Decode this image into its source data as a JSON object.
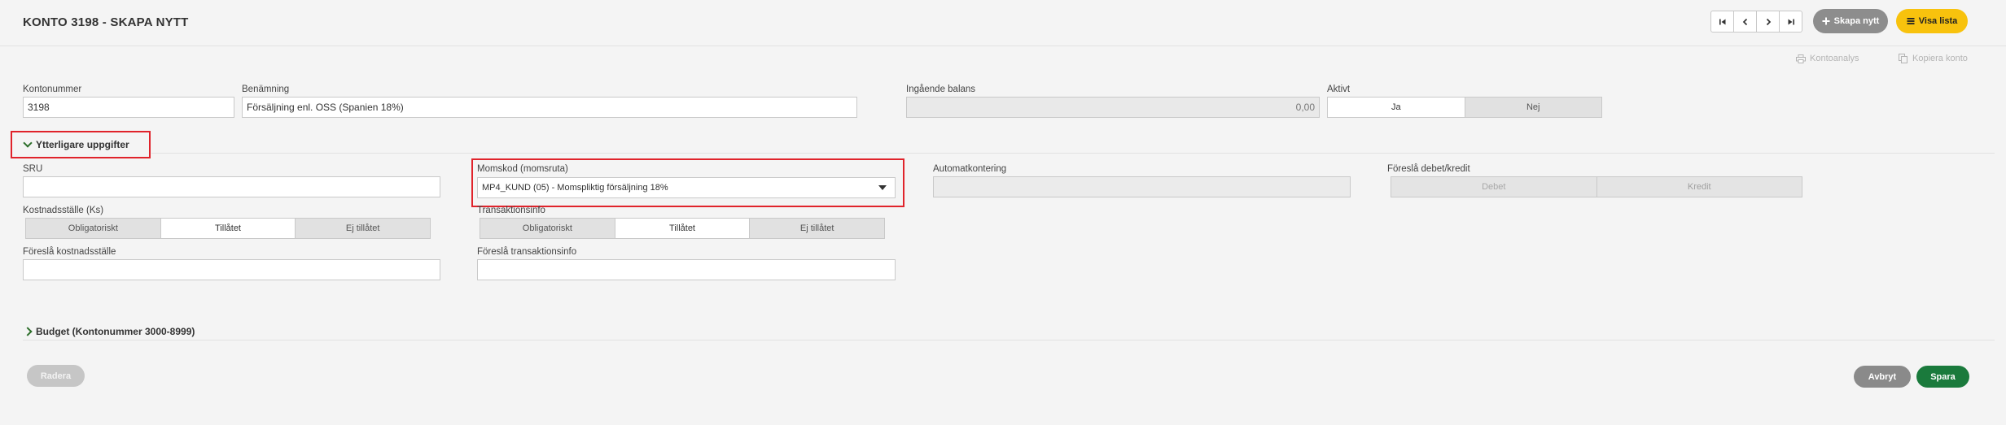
{
  "header": {
    "title": "KONTO 3198 - SKAPA NYTT",
    "create_label": "Skapa nytt",
    "list_label": "Visa lista"
  },
  "tools": {
    "account_analysis": "Kontoanalys",
    "copy_account": "Kopiera konto"
  },
  "form": {
    "account_number": {
      "label": "Kontonummer",
      "value": "3198"
    },
    "name": {
      "label": "Benämning",
      "value": "Försäljning enl. OSS (Spanien 18%)"
    },
    "opening_balance": {
      "label": "Ingående balans",
      "value": "0,00"
    },
    "active": {
      "label": "Aktivt",
      "options": [
        "Ja",
        "Nej"
      ],
      "selected": "Ja"
    }
  },
  "extra": {
    "title": "Ytterligare uppgifter",
    "sru": {
      "label": "SRU",
      "value": ""
    },
    "vat_code": {
      "label": "Momskod (momsruta)",
      "value": "MP4_KUND (05) - Momspliktig försäljning 18%"
    },
    "auto_posting": {
      "label": "Automatkontering",
      "value": ""
    },
    "suggest_debit_credit": {
      "label": "Föreslå debet/kredit",
      "options": [
        "Debet",
        "Kredit"
      ]
    },
    "cost_center": {
      "label": "Kostnadsställe (Ks)",
      "options": [
        "Obligatoriskt",
        "Tillåtet",
        "Ej tillåtet"
      ],
      "selected": "Tillåtet"
    },
    "transaction_info": {
      "label": "Transaktionsinfo",
      "options": [
        "Obligatoriskt",
        "Tillåtet",
        "Ej tillåtet"
      ],
      "selected": "Tillåtet"
    },
    "suggest_cost_center": {
      "label": "Föreslå kostnadsställe",
      "value": ""
    },
    "suggest_transaction_info": {
      "label": "Föreslå transaktionsinfo",
      "value": ""
    }
  },
  "budget": {
    "title": "Budget (Kontonummer 3000-8999)"
  },
  "footer": {
    "delete_label": "Radera",
    "cancel_label": "Avbryt",
    "save_label": "Spara"
  },
  "colors": {
    "accent_yellow": "#f8c20d",
    "save_green": "#1a7a3c",
    "highlight_red": "#e0232b",
    "chevron_green": "#2d6e2a"
  },
  "icons": [
    "first-page-icon",
    "prev-icon",
    "next-icon",
    "last-page-icon",
    "plus-icon",
    "list-icon",
    "print-icon",
    "copy-icon",
    "chevron-down-icon",
    "chevron-right-icon",
    "caret-down-icon"
  ]
}
